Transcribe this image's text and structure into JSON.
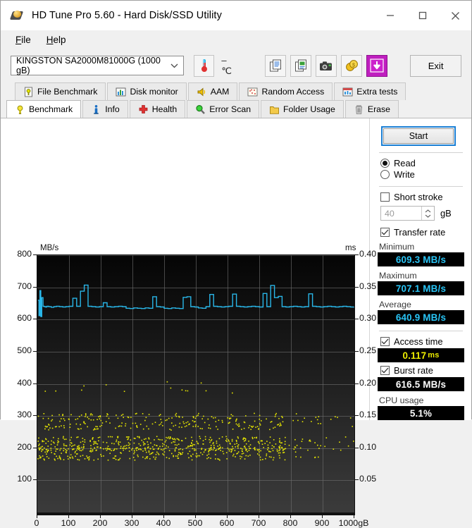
{
  "window": {
    "title": "HD Tune Pro 5.60 - Hard Disk/SSD Utility",
    "minimize_label": "Minimize",
    "maximize_label": "Maximize",
    "close_label": "Close"
  },
  "menu": {
    "items": [
      "File",
      "Help"
    ]
  },
  "toolbar": {
    "drive": "KINGSTON SA2000M81000G (1000 gB)",
    "temperature": "–  ℃",
    "exit_label": "Exit",
    "buttons": [
      "copy-icon",
      "copy-image-icon",
      "screenshot-icon",
      "coins-icon",
      "download-icon"
    ]
  },
  "tabs": {
    "row1": [
      {
        "label": "File Benchmark",
        "icon": "file-benchmark-icon"
      },
      {
        "label": "Disk monitor",
        "icon": "disk-monitor-icon"
      },
      {
        "label": "AAM",
        "icon": "aam-icon"
      },
      {
        "label": "Random Access",
        "icon": "random-access-icon"
      },
      {
        "label": "Extra tests",
        "icon": "extra-tests-icon"
      }
    ],
    "row2": [
      {
        "label": "Benchmark",
        "icon": "benchmark-icon",
        "active": true
      },
      {
        "label": "Info",
        "icon": "info-icon"
      },
      {
        "label": "Health",
        "icon": "health-icon"
      },
      {
        "label": "Error Scan",
        "icon": "error-scan-icon"
      },
      {
        "label": "Folder Usage",
        "icon": "folder-usage-icon"
      },
      {
        "label": "Erase",
        "icon": "erase-icon"
      }
    ]
  },
  "sidebar": {
    "start_label": "Start",
    "mode_read": "Read",
    "mode_write": "Write",
    "short_stroke_label": "Short stroke",
    "short_stroke_value": "40",
    "short_stroke_unit": "gB",
    "transfer_rate_label": "Transfer rate",
    "minimum_label": "Minimum",
    "minimum_value": "609.3 MB/s",
    "maximum_label": "Maximum",
    "maximum_value": "707.1 MB/s",
    "average_label": "Average",
    "average_value": "640.9 MB/s",
    "access_time_label": "Access time",
    "access_time_value": "0.117",
    "access_time_unit": "ms",
    "burst_rate_label": "Burst rate",
    "burst_rate_value": "616.5 MB/s",
    "cpu_usage_label": "CPU usage",
    "cpu_usage_value": "5.1%"
  },
  "colors": {
    "transfer_line": "#29b6e8",
    "access_dots": "#e8e800",
    "accent": "#1a7fd4",
    "plot_bg_top": "#050505",
    "plot_bg_bottom": "#3b3b3b"
  },
  "chart_data": {
    "type": "line",
    "title": "",
    "xlabel": "gB",
    "ylabel": "MB/s",
    "y2label": "ms",
    "grid": true,
    "legend": "none",
    "xlim": [
      0,
      1000
    ],
    "ylim": [
      0,
      800
    ],
    "y2lim": [
      0,
      0.4
    ],
    "xticks": [
      0,
      100,
      200,
      300,
      400,
      500,
      600,
      700,
      800,
      900,
      1000
    ],
    "xticklabels": [
      "0",
      "100",
      "200",
      "300",
      "400",
      "500",
      "600",
      "700",
      "800",
      "900",
      "1000gB"
    ],
    "yticks": [
      100,
      200,
      300,
      400,
      500,
      600,
      700,
      800
    ],
    "yticklabels": [
      "100",
      "200",
      "300",
      "400",
      "500",
      "600",
      "700",
      "800"
    ],
    "y2ticks": [
      0.05,
      0.1,
      0.15,
      0.2,
      0.25,
      0.3,
      0.35,
      0.4
    ],
    "y2ticklabels": [
      "0.05",
      "0.10",
      "0.15",
      "0.20",
      "0.25",
      "0.30",
      "0.35",
      "0.40"
    ],
    "series": [
      {
        "name": "Transfer rate",
        "type": "line",
        "color": "#29b6e8",
        "axis": "left",
        "unit": "MB/s",
        "baseline": 640,
        "x": [
          2,
          5,
          8,
          11,
          14,
          18,
          22,
          26,
          30,
          36,
          44,
          52,
          60,
          70,
          80,
          90,
          100,
          112,
          124,
          136,
          148,
          160,
          172,
          184,
          196,
          208,
          220,
          232,
          244,
          256,
          268,
          280,
          292,
          304,
          316,
          328,
          340,
          352,
          364,
          376,
          388,
          400,
          412,
          424,
          436,
          448,
          460,
          472,
          484,
          496,
          508,
          520,
          532,
          544,
          556,
          568,
          580,
          592,
          604,
          616,
          628,
          640,
          652,
          664,
          676,
          688,
          700,
          712,
          724,
          736,
          748,
          760,
          772,
          784,
          796,
          808,
          820,
          832,
          844,
          856,
          868,
          880,
          892,
          904,
          916,
          928,
          940,
          952,
          964,
          976,
          988,
          998
        ],
        "y": [
          660,
          612,
          690,
          609,
          668,
          641,
          640,
          639,
          641,
          640,
          638,
          640,
          641,
          640,
          639,
          640,
          641,
          666,
          641,
          688,
          707,
          641,
          640,
          639,
          640,
          652,
          640,
          639,
          640,
          641,
          640,
          635,
          634,
          636,
          635,
          634,
          636,
          635,
          671,
          640,
          639,
          635,
          634,
          636,
          635,
          634,
          669,
          671,
          640,
          639,
          636,
          635,
          640,
          678,
          641,
          640,
          639,
          640,
          641,
          679,
          641,
          640,
          639,
          640,
          641,
          640,
          639,
          681,
          640,
          706,
          668,
          672,
          640,
          639,
          640,
          641,
          640,
          639,
          640,
          680,
          641,
          640,
          639,
          640,
          641,
          640,
          639,
          640,
          641,
          640,
          639,
          640
        ]
      },
      {
        "name": "Access time",
        "type": "scatter",
        "color": "#e8e800",
        "axis": "right",
        "unit": "ms",
        "bands_ms": [
          0.142,
          0.108,
          0.092
        ],
        "note": "dense dot clusters spanning 0 to ~900 gB, thinning after 850 gB"
      }
    ],
    "results": {
      "minimum_mbs": 609.3,
      "maximum_mbs": 707.1,
      "average_mbs": 640.9,
      "access_time_ms": 0.117,
      "burst_rate_mbs": 616.5,
      "cpu_usage_pct": 5.1
    }
  }
}
